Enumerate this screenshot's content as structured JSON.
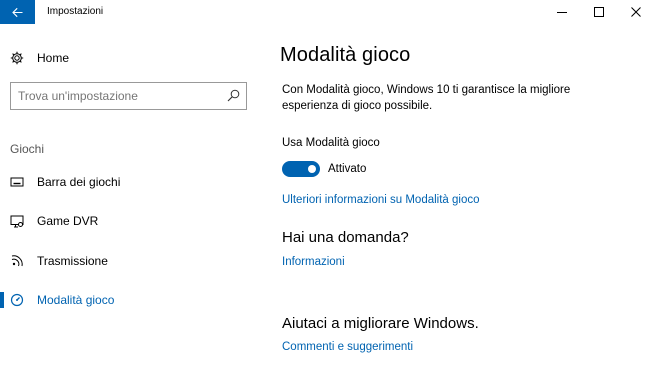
{
  "window": {
    "title": "Impostazioni"
  },
  "sidebar": {
    "home_label": "Home",
    "search_placeholder": "Trova un'impostazione",
    "section_label": "Giochi",
    "items": [
      {
        "label": "Barra dei giochi",
        "icon": "game-bar-icon",
        "selected": false
      },
      {
        "label": "Game DVR",
        "icon": "game-dvr-icon",
        "selected": false
      },
      {
        "label": "Trasmissione",
        "icon": "broadcast-icon",
        "selected": false
      },
      {
        "label": "Modalità gioco",
        "icon": "game-mode-icon",
        "selected": true
      }
    ]
  },
  "main": {
    "title": "Modalità gioco",
    "description": "Con Modalità gioco, Windows 10 ti garantisce la migliore esperienza di gioco possibile.",
    "toggle_label": "Usa Modalità gioco",
    "toggle_state": "Attivato",
    "toggle_on": true,
    "more_info_link": "Ulteriori informazioni su Modalità gioco",
    "question_heading": "Hai una domanda?",
    "info_link": "Informazioni",
    "improve_heading": "Aiutaci a migliorare Windows.",
    "feedback_link": "Commenti e suggerimenti"
  },
  "colors": {
    "accent": "#0063b1"
  }
}
